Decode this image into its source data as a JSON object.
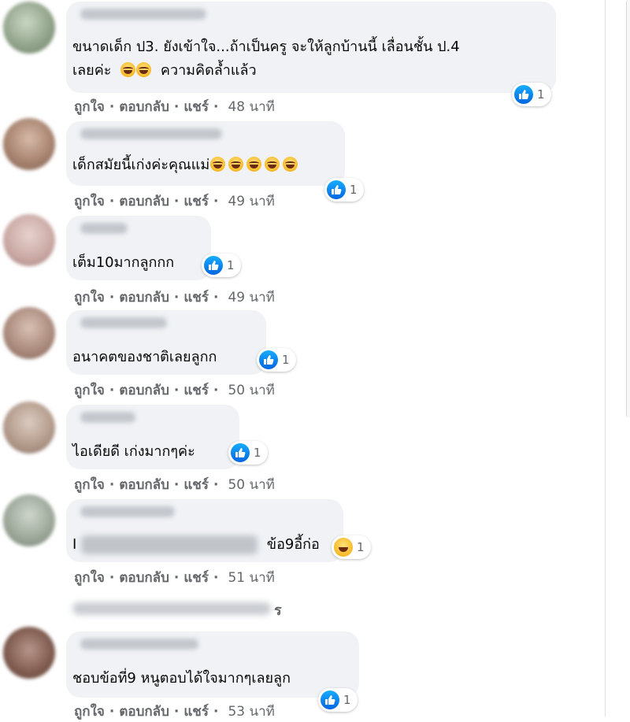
{
  "colors": {
    "bubble": "#f0f2f5",
    "meta": "#65676b",
    "like_blue": "#0866ff",
    "text": "#050505"
  },
  "comments": [
    {
      "line1": "ขนาดเด็ก ป3. ยังเข้าใจ...ถ้าเป็นครู จะให้ลูกบ้านนี้ เลื่อนชั้น ป.4",
      "line2_before": "เลยค่ะ",
      "line2_after": "ความคิดล้ำแล้ว",
      "reaction": {
        "icon": "like-icon",
        "count": "1"
      },
      "actions": {
        "like": "ถูกใจ",
        "reply": "ตอบกลับ",
        "share": "แชร์",
        "time": "48 นาที"
      }
    },
    {
      "text": "เด็กสมัยนี้เก่งค่ะคุณแม่",
      "reaction": {
        "icon": "like-icon",
        "count": "1"
      },
      "actions": {
        "like": "ถูกใจ",
        "reply": "ตอบกลับ",
        "share": "แชร์",
        "time": "49 นาที"
      }
    },
    {
      "text": "เต็ม10มากลูกกก",
      "reaction": {
        "icon": "like-icon",
        "count": "1"
      },
      "actions": {
        "like": "ถูกใจ",
        "reply": "ตอบกลับ",
        "share": "แชร์",
        "time": "49 นาที"
      }
    },
    {
      "text": "อนาคตของชาติเลยลูกก",
      "reaction": {
        "icon": "like-icon",
        "count": "1"
      },
      "actions": {
        "like": "ถูกใจ",
        "reply": "ตอบกลับ",
        "share": "แชร์",
        "time": "50 นาที"
      }
    },
    {
      "text": "ไอเดียดี เก่งมากๆค่ะ",
      "reaction": {
        "icon": "like-icon",
        "count": "1"
      },
      "actions": {
        "like": "ถูกใจ",
        "reply": "ตอบกลับ",
        "share": "แชร์",
        "time": "50 นาที"
      }
    },
    {
      "text_prefix": "I",
      "text": "ข้อ9อี้ก่อ",
      "reaction": {
        "icon": "haha-icon",
        "count": "1"
      },
      "actions": {
        "like": "ถูกใจ",
        "reply": "ตอบกลับ",
        "share": "แชร์",
        "time": "51 นาที"
      }
    },
    {
      "text": "ชอบข้อที่9 หนูตอบได้ใจมากๆเลยลูก",
      "reaction": {
        "icon": "like-icon",
        "count": "1"
      },
      "actions": {
        "like": "ถูกใจ",
        "reply": "ตอบกลับ",
        "share": "แชร์",
        "time": "53 นาที"
      }
    }
  ],
  "reply_fragment": "ร"
}
